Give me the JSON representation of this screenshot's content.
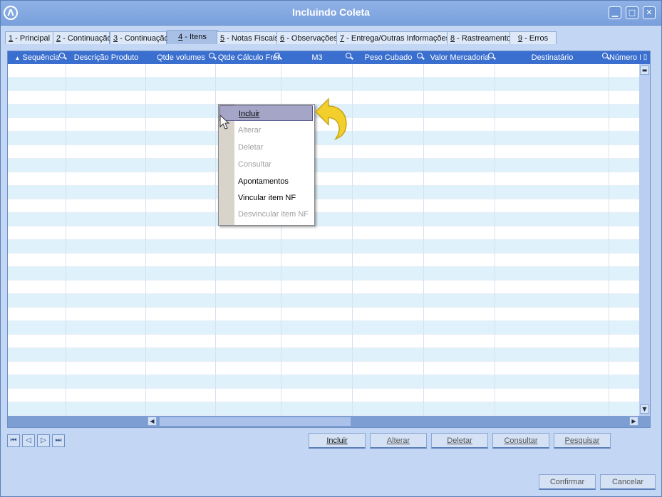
{
  "window": {
    "title": "Incluindo Coleta",
    "icon": "app-logo-icon",
    "controls": [
      "minimize-icon",
      "maximize-icon",
      "close-icon"
    ]
  },
  "tabs": [
    {
      "key": "1",
      "label": " - Principal"
    },
    {
      "key": "2",
      "label": " - Continuação"
    },
    {
      "key": "3",
      "label": " - Continuação"
    },
    {
      "key": "4",
      "label": " - Itens",
      "active": true
    },
    {
      "key": "5",
      "label": " - Notas Fiscais"
    },
    {
      "key": "6",
      "label": " - Observações"
    },
    {
      "key": "7",
      "label": " - Entrega/Outras Informações"
    },
    {
      "key": "8",
      "label": " - Rastreamento"
    },
    {
      "key": "9",
      "label": " - Erros"
    }
  ],
  "grid": {
    "columns": [
      "Sequência",
      "Descrição Produto",
      "Qtde volumes",
      "Qtde Cálculo Fret",
      "M3",
      "Peso Cubado",
      "Valor Mercadoria",
      "Destinatário",
      "Número I"
    ],
    "rows": []
  },
  "context_menu": {
    "items": [
      {
        "label": "Incluir",
        "state": "highlighted"
      },
      {
        "label": "Alterar",
        "state": "disabled"
      },
      {
        "label": "Deletar",
        "state": "disabled"
      },
      {
        "label": "Consultar",
        "state": "disabled"
      },
      {
        "label": "Apontamentos",
        "state": "enabled"
      },
      {
        "label": "Vincular item NF",
        "state": "enabled"
      },
      {
        "label": "Desvincular item NF",
        "state": "disabled"
      }
    ]
  },
  "nav_buttons": [
    "first-icon",
    "prev-icon",
    "next-icon",
    "last-icon"
  ],
  "actions": {
    "incluir": "Incluir",
    "alterar": "Alterar",
    "deletar": "Deletar",
    "consultar": "Consultar",
    "pesquisar": "Pesquisar"
  },
  "footer": {
    "confirmar": "Confirmar",
    "cancelar": "Cancelar"
  },
  "colors": {
    "title": "#7aa0dc",
    "header": "#3a6fcf",
    "row_alt": "#dff1fb",
    "highlight": "#a5a6c7",
    "accent_arrow": "#f2cf2b"
  }
}
